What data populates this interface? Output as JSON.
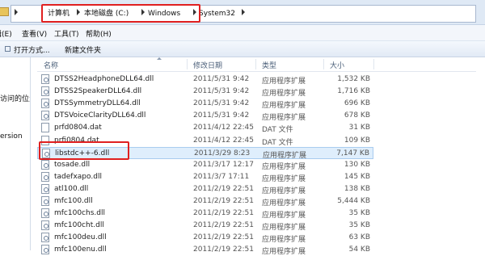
{
  "breadcrumb": [
    "计算机",
    "本地磁盘 (C:)",
    "Windows",
    "System32"
  ],
  "menu": [
    "编辑(E)",
    "查看(V)",
    "工具(T)",
    "帮助(H)"
  ],
  "toolbar": [
    "打开方式...",
    "新建文件夹"
  ],
  "nav": [
    "访问的位置",
    "ersion"
  ],
  "columns": {
    "name": "名称",
    "date": "修改日期",
    "type": "类型",
    "size": "大小"
  },
  "files": [
    {
      "name": "DTSS2HeadphoneDLL64.dll",
      "date": "2011/5/31 9:42",
      "type": "应用程序扩展",
      "size": "1,532 KB",
      "icon": "dll-file-icon"
    },
    {
      "name": "DTSS2SpeakerDLL64.dll",
      "date": "2011/5/31 9:42",
      "type": "应用程序扩展",
      "size": "1,716 KB",
      "icon": "dll-file-icon"
    },
    {
      "name": "DTSSymmetryDLL64.dll",
      "date": "2011/5/31 9:42",
      "type": "应用程序扩展",
      "size": "696 KB",
      "icon": "dll-file-icon"
    },
    {
      "name": "DTSVoiceClarityDLL64.dll",
      "date": "2011/5/31 9:42",
      "type": "应用程序扩展",
      "size": "678 KB",
      "icon": "dll-file-icon"
    },
    {
      "name": "prfd0804.dat",
      "date": "2011/4/12 22:45",
      "type": "DAT 文件",
      "size": "31 KB",
      "icon": "dat-file-icon"
    },
    {
      "name": "prfi0804.dat",
      "date": "2011/4/12 22:45",
      "type": "DAT 文件",
      "size": "109 KB",
      "icon": "dat-file-icon"
    },
    {
      "name": "libstdc++-6.dll",
      "date": "2011/3/29 8:23",
      "type": "应用程序扩展",
      "size": "7,147 KB",
      "icon": "dll-file-icon",
      "selected": true
    },
    {
      "name": "tosade.dll",
      "date": "2011/3/17 12:17",
      "type": "应用程序扩展",
      "size": "130 KB",
      "icon": "dll-file-icon"
    },
    {
      "name": "tadefxapo.dll",
      "date": "2011/3/7 17:11",
      "type": "应用程序扩展",
      "size": "145 KB",
      "icon": "dll-file-icon"
    },
    {
      "name": "atl100.dll",
      "date": "2011/2/19 22:51",
      "type": "应用程序扩展",
      "size": "138 KB",
      "icon": "dll-file-icon"
    },
    {
      "name": "mfc100.dll",
      "date": "2011/2/19 22:51",
      "type": "应用程序扩展",
      "size": "5,444 KB",
      "icon": "dll-file-icon"
    },
    {
      "name": "mfc100chs.dll",
      "date": "2011/2/19 22:51",
      "type": "应用程序扩展",
      "size": "35 KB",
      "icon": "dll-file-icon"
    },
    {
      "name": "mfc100cht.dll",
      "date": "2011/2/19 22:51",
      "type": "应用程序扩展",
      "size": "35 KB",
      "icon": "dll-file-icon"
    },
    {
      "name": "mfc100deu.dll",
      "date": "2011/2/19 22:51",
      "type": "应用程序扩展",
      "size": "63 KB",
      "icon": "dll-file-icon"
    },
    {
      "name": "mfc100enu.dll",
      "date": "2011/2/19 22:51",
      "type": "应用程序扩展",
      "size": "54 KB",
      "icon": "dll-file-icon"
    }
  ],
  "colors": {
    "highlight": "#e02020",
    "selection": "#dfeefc"
  }
}
